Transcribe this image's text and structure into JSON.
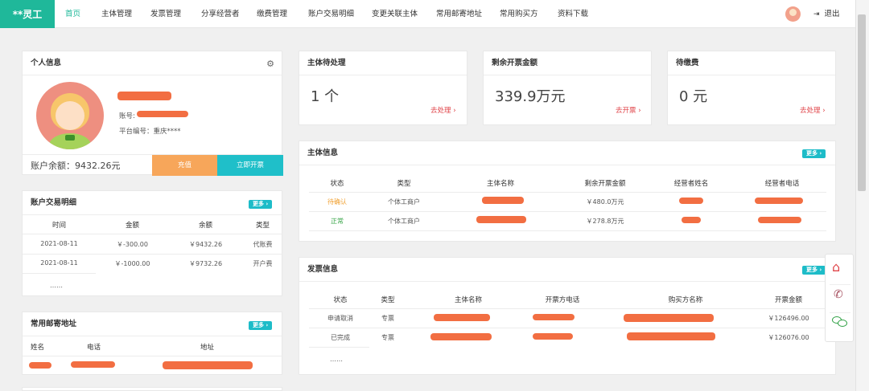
{
  "nav": {
    "logo": "**灵工",
    "items": [
      "首页",
      "主体管理",
      "发票管理",
      "分享经营者",
      "缴费管理",
      "账户交易明细",
      "变更关联主体",
      "常用邮寄地址",
      "常用购买方",
      "资料下载"
    ],
    "logout": "退出"
  },
  "profile": {
    "title": "个人信息",
    "account_label": "账号:",
    "platform_no": "平台编号：重庆****",
    "balance": "账户余额：9432.26元",
    "recharge": "充值",
    "invoice_now": "立即开票"
  },
  "cards": [
    {
      "title": "主体待处理",
      "value": "1 个",
      "link": "去处理 ›"
    },
    {
      "title": "剩余开票金额",
      "value": "339.9万元",
      "link": "去开票 ›"
    },
    {
      "title": "待缴费",
      "value": "0 元",
      "link": "去处理 ›"
    }
  ],
  "more": "更多 ›",
  "transactions": {
    "title": "账户交易明细",
    "headers": [
      "时间",
      "金额",
      "余额",
      "类型"
    ],
    "rows": [
      [
        "2021-08-11",
        "￥-300.00",
        "￥9432.26",
        "代账费"
      ],
      [
        "2021-08-11",
        "￥-1000.00",
        "￥9732.26",
        "开户费"
      ]
    ],
    "ellipsis": "……"
  },
  "mailing": {
    "title": "常用邮寄地址",
    "headers": [
      "姓名",
      "电话",
      "地址"
    ]
  },
  "entity": {
    "title": "主体信息",
    "headers": [
      "状态",
      "类型",
      "主体名称",
      "剩余开票金额",
      "经营者姓名",
      "经营者电话"
    ],
    "rows": [
      {
        "status": "待确认",
        "type": "个体工商户",
        "amount": "￥480.0万元"
      },
      {
        "status": "正常",
        "type": "个体工商户",
        "amount": "￥278.8万元"
      }
    ]
  },
  "invoice": {
    "title": "发票信息",
    "headers": [
      "状态",
      "类型",
      "主体名称",
      "开票方电话",
      "购买方名称",
      "开票金额"
    ],
    "rows": [
      {
        "status": "申请取消",
        "type": "专票",
        "amount": "￥126496.00"
      },
      {
        "status": "已完成",
        "type": "专票",
        "amount": "￥126076.00"
      }
    ],
    "ellipsis": "……"
  },
  "colors": {
    "brand": "#1fb89a",
    "pending": "#f0a030",
    "normal": "#3aa64a",
    "link": "#e0454a",
    "recharge": "#f7a65a",
    "invoice_btn": "#1fbfc9"
  }
}
